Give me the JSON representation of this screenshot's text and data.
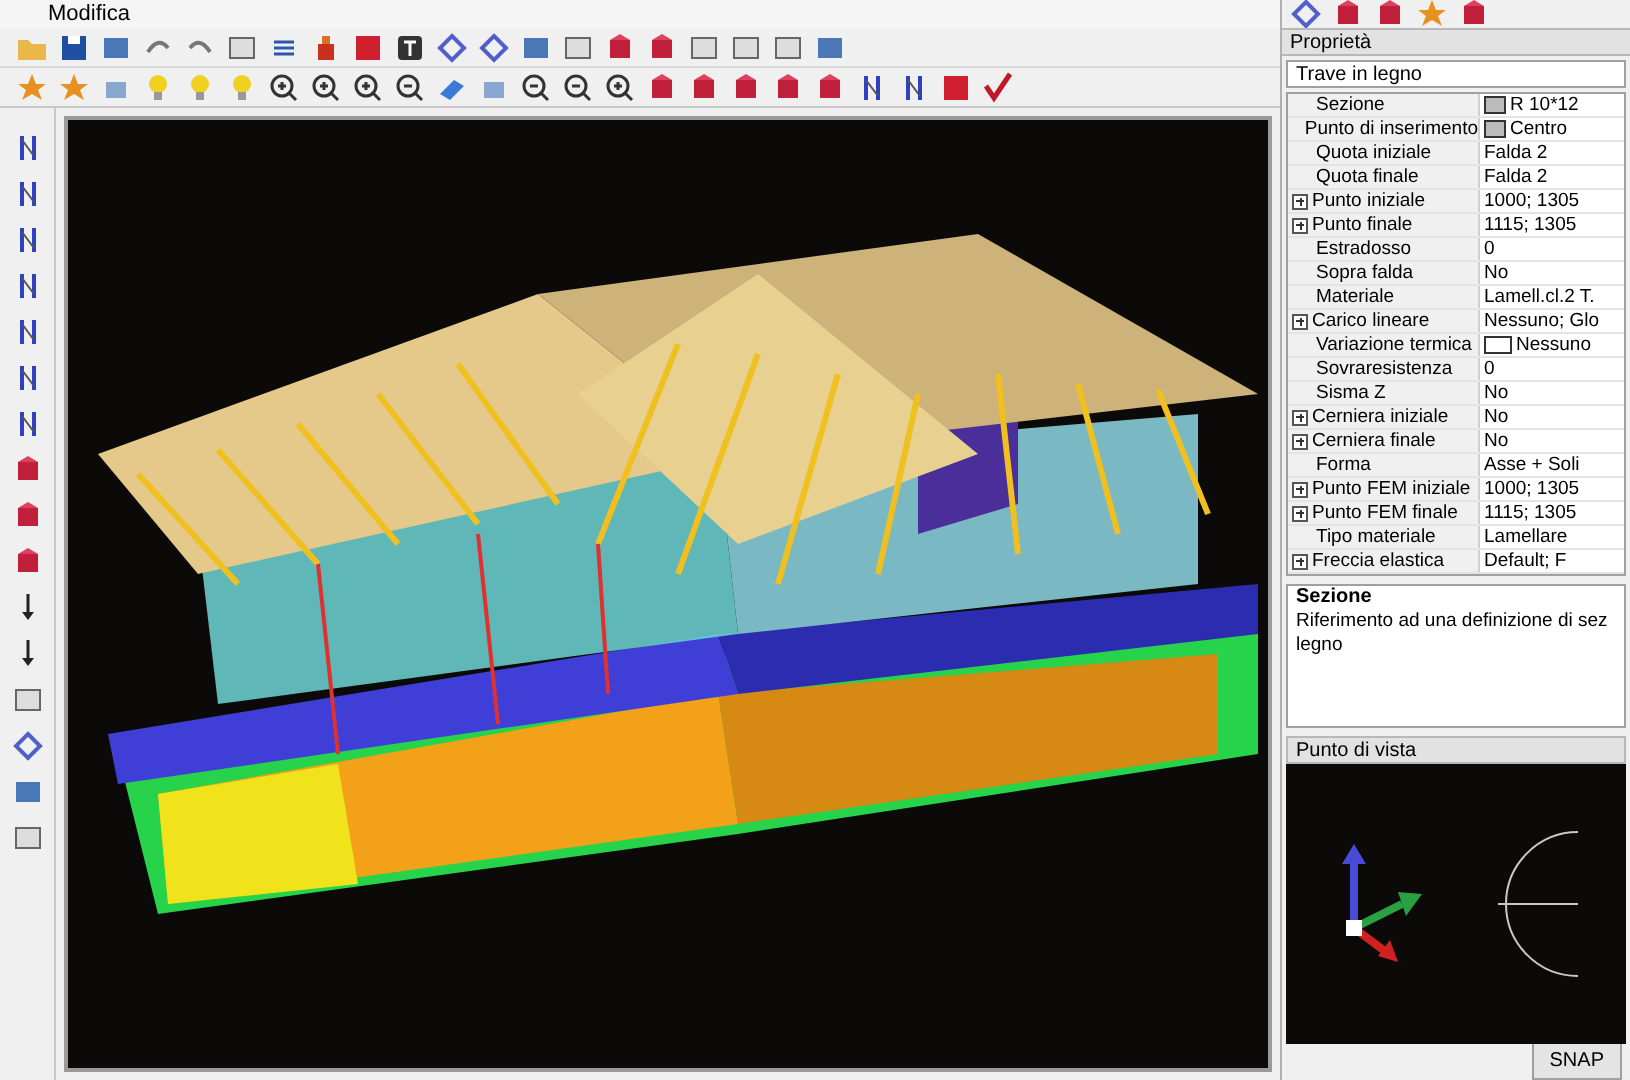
{
  "menu": [
    "Modifica"
  ],
  "properties_panel": {
    "title": "Proprietà",
    "object_type": "Trave in legno",
    "rows": [
      {
        "name": "Sezione",
        "value": "R 10*12",
        "kind": "section"
      },
      {
        "name": "Punto di inserimento",
        "value": "Centro",
        "kind": "section"
      },
      {
        "name": "Quota iniziale",
        "value": "Falda 2",
        "kind": "plain"
      },
      {
        "name": "Quota finale",
        "value": "Falda 2",
        "kind": "plain"
      },
      {
        "name": "Punto iniziale",
        "value": "1000; 1305",
        "kind": "group",
        "expanded": false
      },
      {
        "name": "Punto finale",
        "value": "1115; 1305",
        "kind": "group",
        "expanded": false
      },
      {
        "name": "Estradosso",
        "value": "0",
        "kind": "plain"
      },
      {
        "name": "Sopra falda",
        "value": "No",
        "kind": "plain"
      },
      {
        "name": "Materiale",
        "value": "Lamell.cl.2 T.",
        "kind": "plain"
      },
      {
        "name": "Carico lineare",
        "value": "Nessuno; Glo",
        "kind": "group",
        "expanded": false
      },
      {
        "name": "Variazione termica",
        "value": "Nessuno",
        "kind": "swatch"
      },
      {
        "name": "Sovraresistenza",
        "value": "0",
        "kind": "plain"
      },
      {
        "name": "Sisma Z",
        "value": "No",
        "kind": "plain"
      },
      {
        "name": "Cerniera iniziale",
        "value": "No",
        "kind": "group",
        "expanded": false
      },
      {
        "name": "Cerniera finale",
        "value": "No",
        "kind": "group",
        "expanded": false
      },
      {
        "name": "Forma",
        "value": "Asse + Soli",
        "kind": "plain"
      },
      {
        "name": "Punto FEM iniziale",
        "value": "1000; 1305",
        "kind": "group",
        "expanded": false
      },
      {
        "name": "Punto FEM finale",
        "value": "1115; 1305",
        "kind": "group",
        "expanded": false
      },
      {
        "name": "Tipo materiale",
        "value": "Lamellare",
        "kind": "plain"
      },
      {
        "name": "Freccia elastica",
        "value": "Default; F",
        "kind": "group",
        "expanded": false
      }
    ],
    "description": {
      "title": "Sezione",
      "lines": [
        "Riferimento ad una definizione di sez",
        "legno"
      ]
    }
  },
  "viewpoint_panel": {
    "title": "Punto di vista"
  },
  "bottom_tabs": [
    {
      "label": "SNAP",
      "selected": false
    }
  ]
}
